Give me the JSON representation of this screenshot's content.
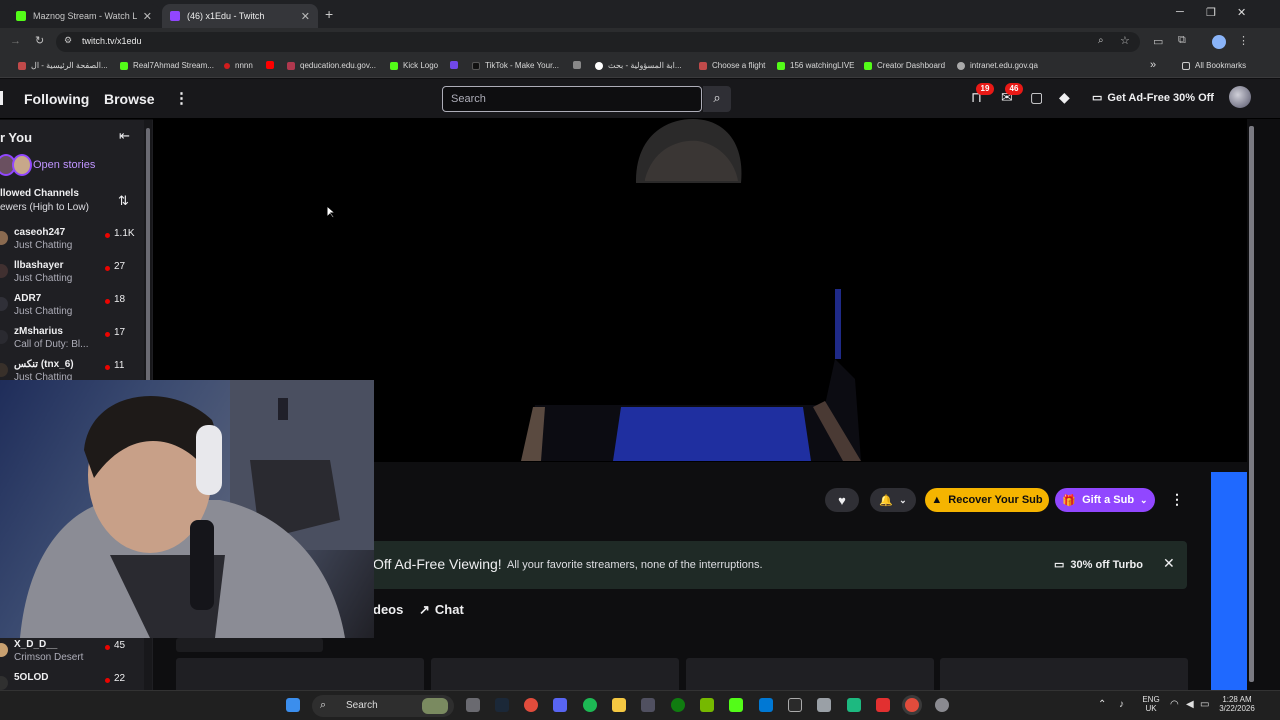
{
  "browser": {
    "tabs": [
      {
        "title": "Maznog Stream - Watch Live o",
        "favicon_color": "#53fc18",
        "active": false
      },
      {
        "title": "(46) x1Edu - Twitch",
        "favicon_color": "#9146ff",
        "active": true
      }
    ],
    "new_tab": "+",
    "url": "twitch.tv/x1edu",
    "bookmarks": [
      {
        "label": "الصفحة الرئيسية - ال...",
        "color": "#c04a4a"
      },
      {
        "label": "Real7Ahmad Stream...",
        "color": "#53fc18"
      },
      {
        "label": "nnnn",
        "color": "#d21d1d"
      },
      {
        "label": "",
        "color": "#ff0000"
      },
      {
        "label": "qeducation.edu.gov...",
        "color": "#b0384e"
      },
      {
        "label": "Kick Logo",
        "color": "#53fc18"
      },
      {
        "label": "",
        "color": "#7048e8"
      },
      {
        "label": "TikTok - Make Your...",
        "color": "#111111"
      },
      {
        "label": "",
        "color": "#888888"
      },
      {
        "label": "ابة المسؤولية - بحث...",
        "color": "#ffffff"
      },
      {
        "label": "Choose a flight",
        "color": "#c04a4a"
      },
      {
        "label": "156 watchingLIVE",
        "color": "#53fc18"
      },
      {
        "label": "Creator Dashboard",
        "color": "#53fc18"
      },
      {
        "label": "intranet.edu.gov.qa",
        "color": "#aaaaaa"
      }
    ],
    "all_bookmarks": "All Bookmarks",
    "more_bookmarks": "»"
  },
  "topnav": {
    "following": "Following",
    "browse": "Browse",
    "more": "⋮",
    "search_placeholder": "Search",
    "notifications_badge": "19",
    "inbox_badge": "46",
    "adfree_label": "Get Ad-Free 30% Off"
  },
  "sidebar": {
    "header": "r You",
    "open_stories": "Open stories",
    "section_title": "llowed Channels",
    "section_sort": "ewers (High to Low)",
    "channels": [
      {
        "name": "caseoh247",
        "game": "Just Chatting",
        "viewers": "1.1K"
      },
      {
        "name": "llbashayer",
        "game": "Just Chatting",
        "viewers": "27"
      },
      {
        "name": "ADR7",
        "game": "Just Chatting",
        "viewers": "18"
      },
      {
        "name": "zMsharius",
        "game": "Call of Duty: Bl...",
        "viewers": "17"
      },
      {
        "name": "تنكس (tnx_6)",
        "game": "Just Chatting",
        "viewers": "11"
      },
      {
        "name": "X_D_D__",
        "game": "Crimson Desert",
        "viewers": "45"
      },
      {
        "name": "5OLOD",
        "game": "",
        "viewers": "22"
      }
    ]
  },
  "channel": {
    "recover_sub": "Recover Your Sub",
    "gift_sub": "Gift a Sub",
    "more": "⋮"
  },
  "promo": {
    "headline": "Off Ad-Free Viewing!",
    "subtext": "All your favorite streamers, none of the interruptions.",
    "offer": "30% off Turbo",
    "close": "✕"
  },
  "tabs": {
    "videos": "deos",
    "chat": "Chat"
  },
  "taskbar": {
    "search": "Search",
    "lang_top": "ENG",
    "lang_bottom": "UK",
    "time": "1:28 AM",
    "date": "3/22/2026"
  }
}
